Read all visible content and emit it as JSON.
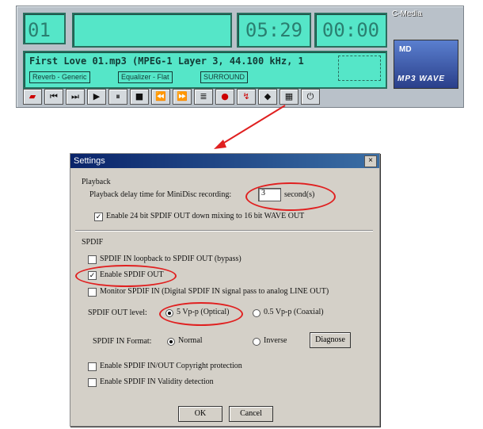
{
  "player": {
    "track_number": "01",
    "time_elapsed": "05:29",
    "time_remaining": "00:00",
    "now_playing": "First Love 01.mp3 (MPEG-1 Layer 3, 44.100 kHz, 1",
    "reverb_label": "Reverb - Generic",
    "equalizer_label": "Equalizer - Flat",
    "surround_label": "SURROUND",
    "brand": "C-Media",
    "logo_md": "MD",
    "logo_wave": "MP3 WAVE",
    "controls": [
      "open",
      "prev-track",
      "next-track",
      "play",
      "pause",
      "stop",
      "rewind",
      "fast-forward",
      "playlist",
      "record",
      "settings",
      "options",
      "equalizer",
      "power"
    ]
  },
  "dialog": {
    "title": "Settings",
    "close_glyph": "×",
    "playback_group": "Playback",
    "delay_label": "Playback delay time for MiniDisc recording:",
    "delay_value": "3",
    "delay_unit": "second(s)",
    "enable_24bit": "Enable 24 bit SPDIF OUT down mixing to 16 bit WAVE OUT",
    "spdif_group": "SPDIF",
    "loopback": "SPDIF IN loopback to SPDIF OUT (bypass)",
    "enable_spdif_out": "Enable SPDIF OUT",
    "monitor_spdif_in": "Monitor SPDIF IN (Digital SPDIF IN signal pass to analog LINE OUT)",
    "out_level_label": "SPDIF OUT level:",
    "out_level_5v": "5 Vp-p (Optical)",
    "out_level_05v": "0.5 Vp-p (Coaxial)",
    "in_format_label": "SPDIF IN Format:",
    "format_normal": "Normal",
    "format_inverse": "Inverse",
    "diagnose_button": "Diagnose",
    "copyright_protection": "Enable SPDIF IN/OUT Copyright protection",
    "validity_detection": "Enable SPDIF IN Validity detection",
    "ok_button": "OK",
    "cancel_button": "Cancel",
    "checkmark": "✓"
  },
  "colors": {
    "lcd": "#55e6c8",
    "annotation": "#e02020",
    "titlebar": "#0a246a"
  }
}
